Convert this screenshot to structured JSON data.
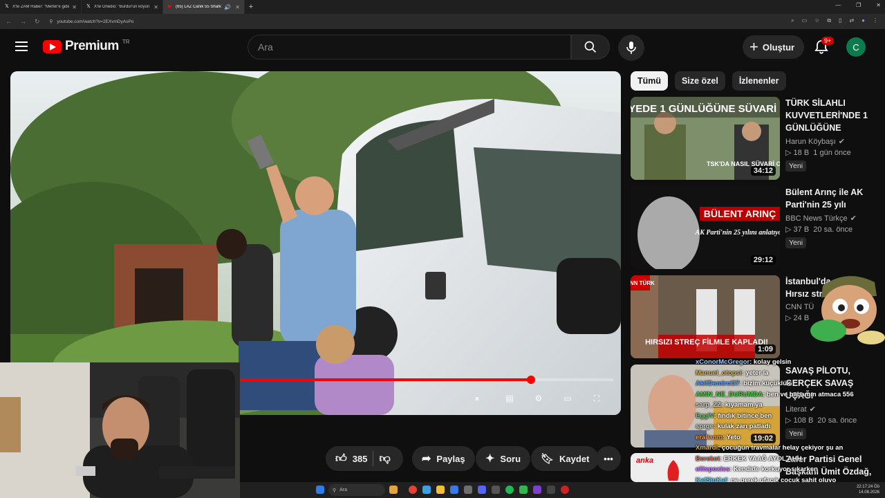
{
  "browser": {
    "tabs": [
      {
        "icon": "x-logo-icon",
        "title": "X'te ZAM Haber: \"Merter'e gide"
      },
      {
        "icon": "x-logo-icon",
        "title": "X'te Onedio: \"Burdur'un köyün"
      },
      {
        "icon": "youtube-icon",
        "title": "(65) LAZ Canik 55 Shark FC",
        "active": true
      }
    ],
    "url": "youtube.com/watch?v=2EXvmDyAsPo"
  },
  "header": {
    "brand": "Premium",
    "country": "TR",
    "search_placeholder": "Ara",
    "create_label": "Oluştur",
    "notif_count": "9+",
    "avatar_letter": "C"
  },
  "player": {
    "progress": 0.78
  },
  "actions": {
    "like_count": "385",
    "share": "Paylaş",
    "ask": "Soru",
    "save": "Kaydet"
  },
  "chips": [
    "Tümü",
    "Size özel",
    "İzlenenler"
  ],
  "recommendations": [
    {
      "title": "TÜRK SİLAHLI KUVVETLERİ'NDE 1 GÜNLÜĞÜNE SÜVAR...",
      "channel": "Harun Köybaşı",
      "views": "18 B",
      "age": "1 gün önce",
      "duration": "34:12",
      "badge": "Yeni",
      "thumb_text": "ASKERİYEDE 1 GÜNLÜĞÜNE SÜVARİ OLDUM!",
      "thumb_sub": "TSK'DA NASIL SÜVARİ OLUNUR?"
    },
    {
      "title": "Bülent Arınç ile AK Parti'nin 25 yılı",
      "channel": "BBC News Türkçe",
      "views": "37 B",
      "age": "20 sa. önce",
      "duration": "29:12",
      "badge": "Yeni",
      "thumb_text": "BÜLENT ARINÇ",
      "thumb_sub": "AK Parti'nin 25 yılını anlatıyor"
    },
    {
      "title": "İstanbul'da olay: Hırsız streç filme",
      "channel": "CNN TÜ",
      "views": "24 B",
      "age": "",
      "duration": "1:09",
      "badge": "",
      "thumb_text": "HIRSIZI STREÇ FİLMLE KAPLADI!",
      "thumb_sub": "CNN TÜRK"
    },
    {
      "title": "SAVAŞ PİLOTU, GERÇEK SAVAŞ UÇAĞI VİDEOLARINI...",
      "channel": "Literat",
      "views": "108 B",
      "age": "20 sa. önce",
      "duration": "19:02",
      "badge": "Yeni",
      "thumb_text": "",
      "thumb_sub": ""
    },
    {
      "title": "Zafer Partisi Genel Başkanı Ümit Özdağ,",
      "channel": "",
      "views": "",
      "age": "",
      "duration": "",
      "badge": "",
      "thumb_text": "anka",
      "thumb_sub": ""
    }
  ],
  "chat": [
    {
      "user": "xConorMcGregor",
      "msg": ": kolay gelsin",
      "color": "#9ecbff"
    },
    {
      "user": "Manuel_otopsi",
      "msg": ": yeter la",
      "color": "#e0b04a"
    },
    {
      "user": "AkifDemirci37",
      "msg": ": bizim küçüklük",
      "color": "#5aa0ff"
    },
    {
      "user": "AMIN_NE_DURUMDA",
      "msg": ": ben ve babamın atmaca 556",
      "color": "#47d14a"
    },
    {
      "user": "sarp_ZZ",
      "msg": ": kıyamam ya",
      "color": "#d0d0d0"
    },
    {
      "user": "EggIV",
      "msg": ": fındık bitince ben",
      "color": "#6ad16a"
    },
    {
      "user": "sprge",
      "msg": ": kulak zarı patladı",
      "color": "#d0d0d0"
    },
    {
      "user": "eralianm",
      "msg": ": Yeto",
      "color": "#e59a5a"
    },
    {
      "user": "Xmardi",
      "msg": ": çocuğun travmalar helay çekiyor şu an",
      "color": "#e0b04a"
    },
    {
      "user": "Bereket",
      "msg": ": ERKEK YAAĞ AYOL AHH",
      "color": "#e06a6a"
    },
    {
      "user": "elitepoxies",
      "msg": ": Kendide korkuyor sıkarken",
      "color": "#d080ff"
    },
    {
      "user": "KafSinKaf",
      "msg": ": ne gerek ufacık çocuk şahit oluyo",
      "color": "#5ad0ff"
    }
  ],
  "taskbar": {
    "search": "Ara",
    "time": "22:17:24 Öö",
    "date": "14.08.2026"
  }
}
